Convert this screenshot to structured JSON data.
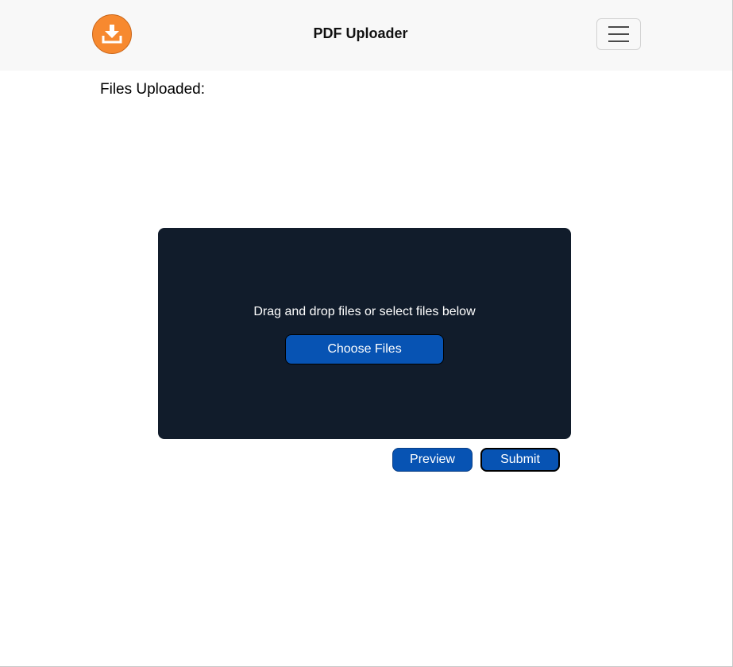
{
  "navbar": {
    "logo_icon": "download-tray-icon",
    "logo_color": "#f7892f",
    "brand": "PDF Uploader",
    "menu_icon": "hamburger-menu-icon"
  },
  "main": {
    "files_heading": "Files Uploaded:"
  },
  "dropzone": {
    "instructions": "Drag and drop files or select files below",
    "choose_label": "Choose Files",
    "background_color": "#111c2b"
  },
  "actions": {
    "preview_label": "Preview",
    "submit_label": "Submit",
    "button_color": "#0753b3"
  }
}
